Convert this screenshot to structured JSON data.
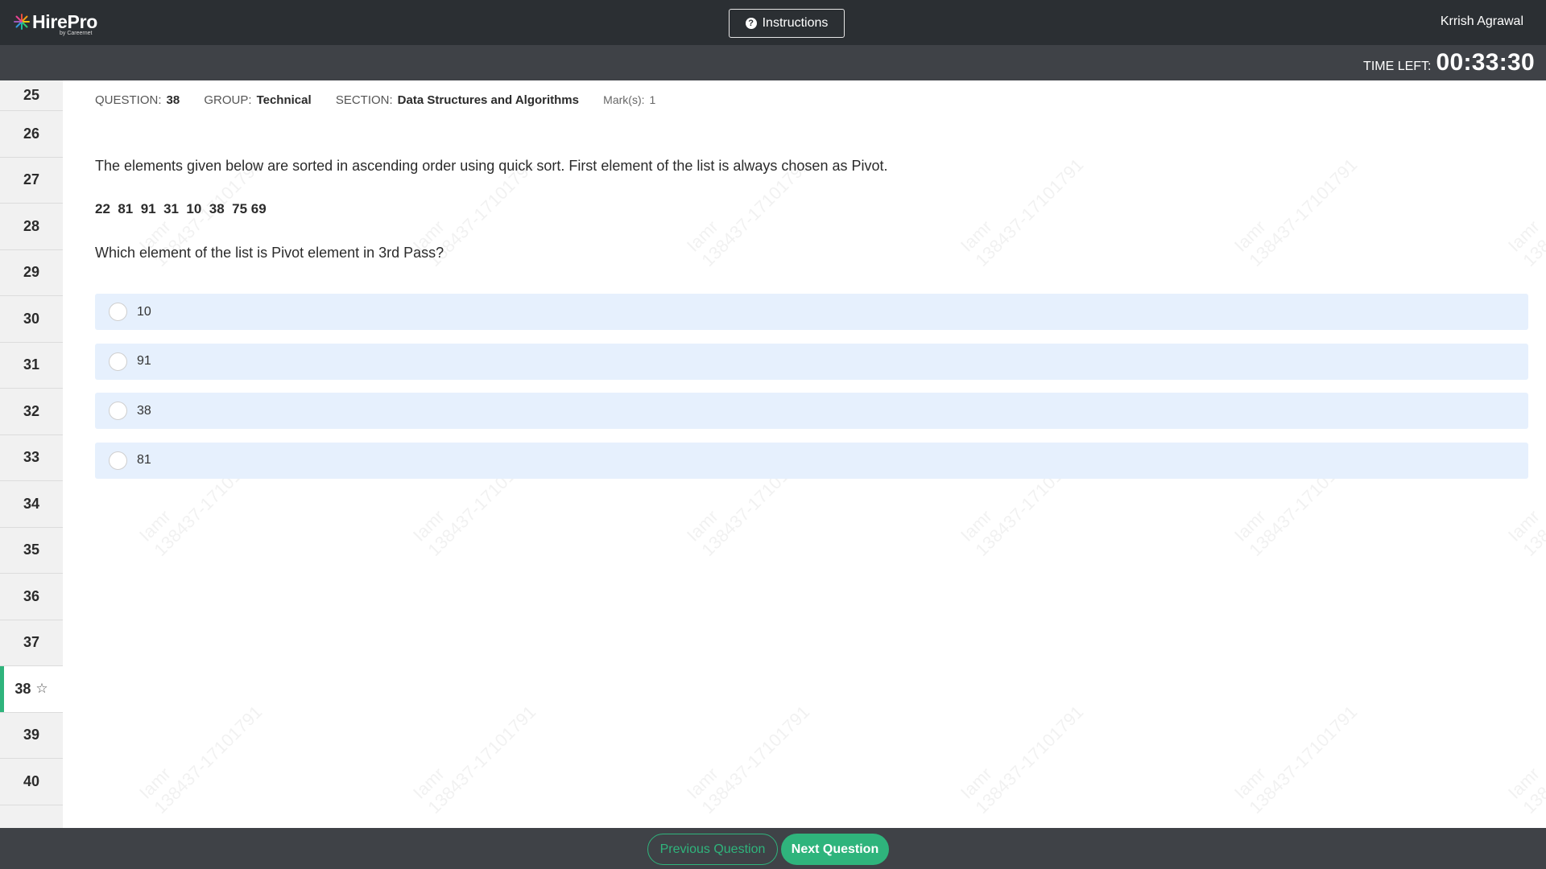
{
  "header": {
    "logo_text": "HirePro",
    "logo_sub": "by Careernet",
    "instructions_label": "Instructions",
    "user_name": "Krrish Agrawal"
  },
  "timer": {
    "label": "TIME LEFT:",
    "value": "00:33:30"
  },
  "sidebar": {
    "questions": [
      "25",
      "26",
      "27",
      "28",
      "29",
      "30",
      "31",
      "32",
      "33",
      "34",
      "35",
      "36",
      "37",
      "38",
      "39",
      "40"
    ],
    "active": "38"
  },
  "watermark_text": "Iamr\n138437-17101791",
  "question": {
    "number_label": "QUESTION:",
    "number": "38",
    "group_label": "GROUP:",
    "group": "Technical",
    "section_label": "SECTION:",
    "section": "Data Structures and Algorithms",
    "marks_label": "Mark(s):",
    "marks": "1",
    "text": "The elements given below are sorted in ascending order using quick sort. First element of the list is always chosen as Pivot.",
    "list": "22  81  91  31  10  38  75 69",
    "ask": "Which element of the list is Pivot element in 3rd Pass?",
    "options": [
      "10",
      "91",
      "38",
      "81"
    ]
  },
  "footer": {
    "prev_label": "Previous Question",
    "next_label": "Next Question"
  },
  "colors": {
    "header_bg": "#2b2f33",
    "bar_bg": "#3f4247",
    "accent": "#2fb47c",
    "option_bg": "#e6f0fd"
  }
}
